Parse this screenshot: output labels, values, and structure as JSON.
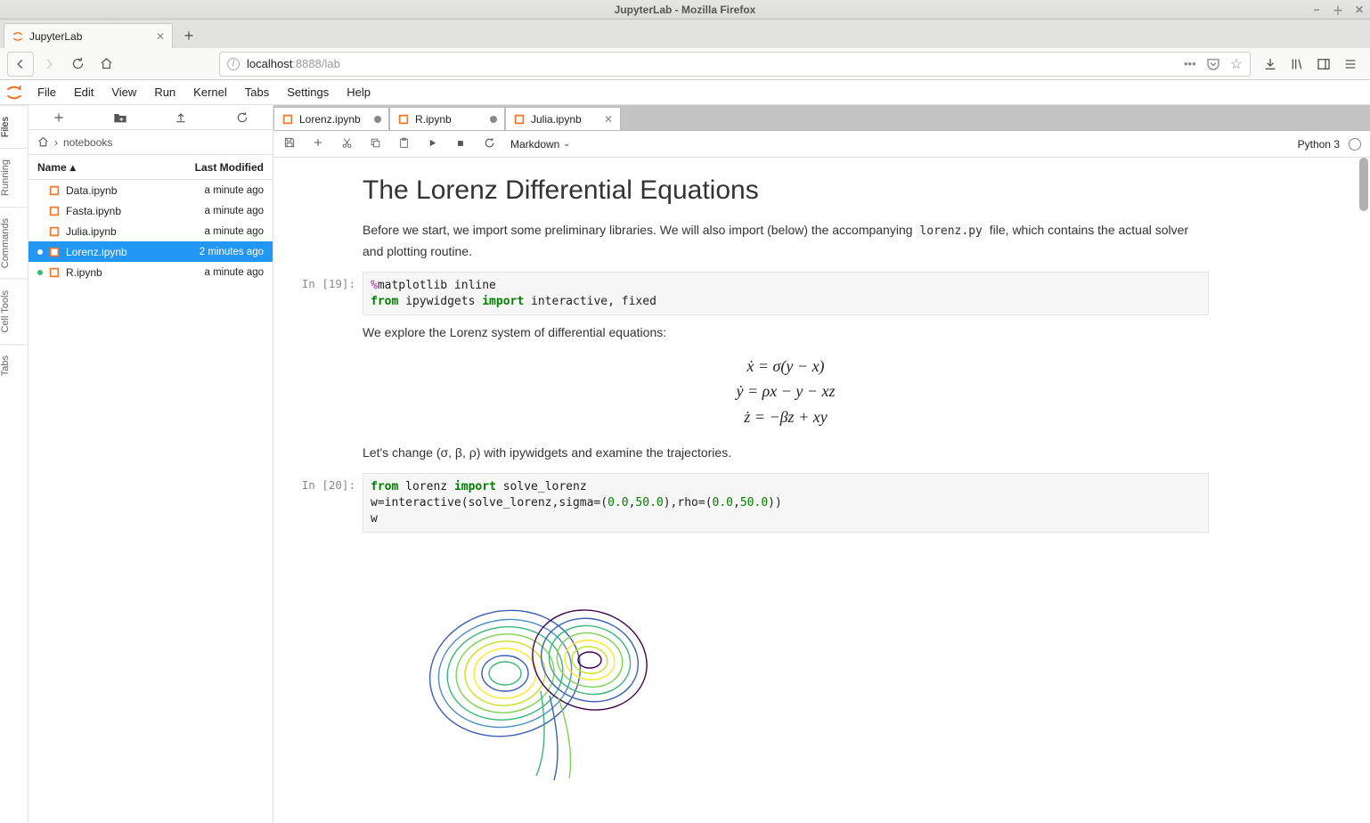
{
  "window_title": "JupyterLab - Mozilla Firefox",
  "browser": {
    "tab_title": "JupyterLab",
    "url_host": "localhost",
    "url_rest": ":8888/lab"
  },
  "menubar": [
    "File",
    "Edit",
    "View",
    "Run",
    "Kernel",
    "Tabs",
    "Settings",
    "Help"
  ],
  "left_rail": [
    "Files",
    "Running",
    "Commands",
    "Cell Tools",
    "Tabs"
  ],
  "breadcrumb": "notebooks",
  "file_header": {
    "name": "Name",
    "modified": "Last Modified"
  },
  "files": [
    {
      "name": "Data.ipynb",
      "modified": "a minute ago",
      "running": false,
      "selected": false
    },
    {
      "name": "Fasta.ipynb",
      "modified": "a minute ago",
      "running": false,
      "selected": false
    },
    {
      "name": "Julia.ipynb",
      "modified": "a minute ago",
      "running": false,
      "selected": false
    },
    {
      "name": "Lorenz.ipynb",
      "modified": "2 minutes ago",
      "running": true,
      "selected": true
    },
    {
      "name": "R.ipynb",
      "modified": "a minute ago",
      "running": true,
      "selected": false
    }
  ],
  "doc_tabs": [
    {
      "label": "Lorenz.ipynb",
      "dirty": true,
      "close": false
    },
    {
      "label": "R.ipynb",
      "dirty": true,
      "close": false
    },
    {
      "label": "Julia.ipynb",
      "dirty": false,
      "close": true
    }
  ],
  "nb_toolbar": {
    "cell_type": "Markdown",
    "kernel": "Python 3"
  },
  "notebook": {
    "title": "The Lorenz Differential Equations",
    "intro": "Before we start, we import some preliminary libraries. We will also import (below) the accompanying ",
    "intro_code": "lorenz.py",
    "intro2": " file, which contains the actual solver and plotting routine.",
    "prompt1": "In [19]:",
    "code1_l1a": "%",
    "code1_l1b": "matplotlib inline",
    "code1_l2a": "from",
    "code1_l2b": " ipywidgets ",
    "code1_l2c": "import",
    "code1_l2d": " interactive, fixed",
    "explore": "We explore the Lorenz system of differential equations:",
    "eq1": "ẋ = σ(y − x)",
    "eq2": "ẏ = ρx − y − xz",
    "eq3": "ż = −βz + xy",
    "change": "Let's change (σ, β, ρ) with ipywidgets and examine the trajectories.",
    "prompt2": "In [20]:",
    "code2_l1a": "from",
    "code2_l1b": " lorenz ",
    "code2_l1c": "import",
    "code2_l1d": " solve_lorenz",
    "code2_l2a": "w=interactive(solve_lorenz,sigma=(",
    "code2_l2b": "0.0",
    "code2_l2c": ",",
    "code2_l2d": "50.0",
    "code2_l2e": "),rho=(",
    "code2_l2f": "0.0",
    "code2_l2g": ",",
    "code2_l2h": "50.0",
    "code2_l2i": "))",
    "code2_l3": "w"
  }
}
